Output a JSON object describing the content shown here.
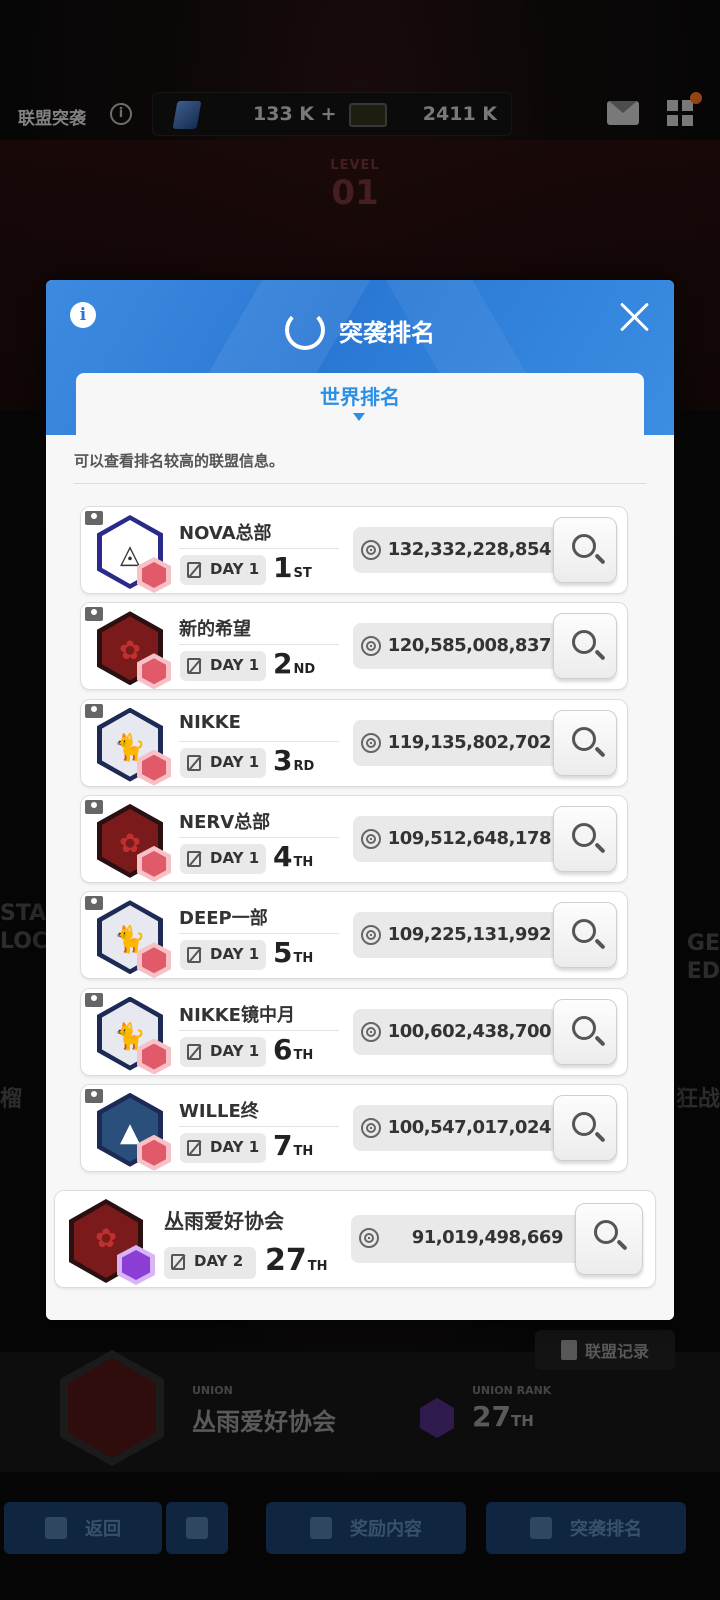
{
  "top": {
    "title": "联盟突袭",
    "resource1": "133 K +",
    "resource2": "2411 K",
    "level_label": "LEVEL",
    "level_number": "01"
  },
  "background_side": {
    "left_lines": [
      "STA",
      "LOC"
    ],
    "right_lines": [
      "GE",
      "ED"
    ],
    "left_cn": "榴",
    "right_cn": "狂战"
  },
  "modal": {
    "title": "突袭排名",
    "tab": "世界排名",
    "hint": "可以查看排名较高的联盟信息。",
    "rows": [
      {
        "name": "NOVA总部",
        "day": "DAY 1",
        "rank": "1",
        "suffix": "ST",
        "score": "132,332,228,854",
        "emblem": "triangle",
        "colors": {
          "outer": "#2a2a8a",
          "inner": "#ffffff"
        }
      },
      {
        "name": "新的希望",
        "day": "DAY 1",
        "rank": "2",
        "suffix": "ND",
        "score": "120,585,008,837",
        "emblem": "flower",
        "colors": {
          "outer": "#2a1010",
          "inner": "#7a1a1a"
        }
      },
      {
        "name": "NIKKE",
        "day": "DAY 1",
        "rank": "3",
        "suffix": "RD",
        "score": "119,135,802,702",
        "emblem": "cat",
        "colors": {
          "outer": "#1c2a55",
          "inner": "#e8e8f0"
        }
      },
      {
        "name": "NERV总部",
        "day": "DAY 1",
        "rank": "4",
        "suffix": "TH",
        "score": "109,512,648,178",
        "emblem": "flower",
        "colors": {
          "outer": "#2a1010",
          "inner": "#7a1a1a"
        }
      },
      {
        "name": "DEEP一部",
        "day": "DAY 1",
        "rank": "5",
        "suffix": "TH",
        "score": "109,225,131,992",
        "emblem": "cat",
        "colors": {
          "outer": "#1c2a55",
          "inner": "#e8e8f0"
        }
      },
      {
        "name": "NIKKE镜中月",
        "day": "DAY 1",
        "rank": "6",
        "suffix": "TH",
        "score": "100,602,438,700",
        "emblem": "cat",
        "colors": {
          "outer": "#1c2a55",
          "inner": "#e8e8f0"
        }
      },
      {
        "name": "WILLE终",
        "day": "DAY 1",
        "rank": "7",
        "suffix": "TH",
        "score": "100,547,017,024",
        "emblem": "mountain",
        "colors": {
          "outer": "#1c2a55",
          "inner": "#2a4f7a"
        }
      }
    ],
    "my_row": {
      "name": "丛雨爱好协会",
      "day": "DAY 2",
      "rank": "27",
      "suffix": "TH",
      "score": "91,019,498,669",
      "emblem": "flower",
      "colors": {
        "outer": "#2a1010",
        "inner": "#7a1a1a"
      }
    }
  },
  "union_panel": {
    "log_button": "联盟记录",
    "union_label": "UNION",
    "union_name": "丛雨爱好协会",
    "rank_label": "UNION RANK",
    "rank_value": "27",
    "rank_suffix": "TH"
  },
  "nav": {
    "back": "返回",
    "rewards": "奖励内容",
    "ranking": "突袭排名"
  },
  "icons": {
    "info": "info-icon",
    "close": "close-icon",
    "search": "magnifier-icon",
    "target": "crosshair-icon",
    "day_switch": "swap-icon"
  }
}
